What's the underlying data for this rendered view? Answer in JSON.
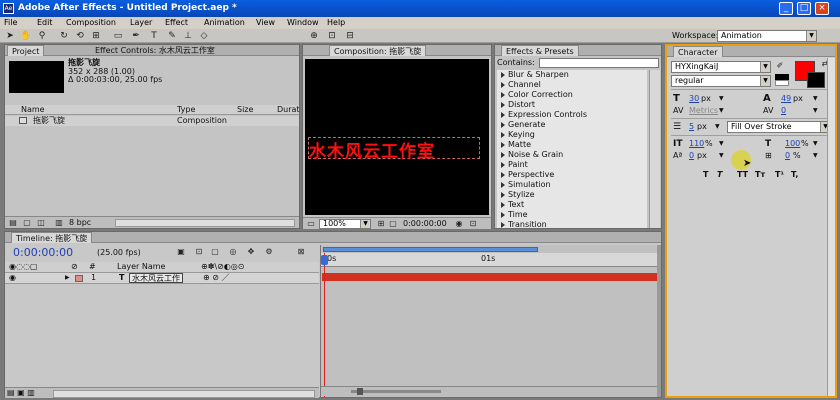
{
  "window": {
    "title": "Adobe After Effects - Untitled Project.aep *",
    "app_icon": "Ae",
    "min_glyph": "_",
    "max_glyph": "□",
    "close_glyph": "×"
  },
  "menubar": [
    "File",
    "Edit",
    "Composition",
    "Layer",
    "Effect",
    "Animation",
    "View",
    "Window",
    "Help"
  ],
  "toolbar": {
    "workspace_label": "Workspace:",
    "workspace_value": "Animation"
  },
  "project_panel": {
    "tab_project": "Project",
    "tab_effect_controls": "Effect Controls: 水木风云工作室",
    "item_name": "拖影飞旋",
    "item_dimensions": "352 x 288 (1.00)",
    "item_duration": "Δ 0:00:03:00, 25.00 fps",
    "columns": [
      "Name",
      "Type",
      "Size",
      "Durat"
    ],
    "rows": [
      {
        "name": "拖影飞旋",
        "type": "Composition"
      }
    ],
    "bpc": "8 bpc"
  },
  "composition_panel": {
    "tab": "Composition: 拖影飞旋",
    "text": "水木风云工作室",
    "zoom": "100%",
    "timecode": "0:00:00:00"
  },
  "effects_panel": {
    "tab": "Effects & Presets",
    "contains_label": "Contains:",
    "items": [
      "Blur & Sharpen",
      "Channel",
      "Color Correction",
      "Distort",
      "Expression Controls",
      "Generate",
      "Keying",
      "Matte",
      "Noise & Grain",
      "Paint",
      "Perspective",
      "Simulation",
      "Stylize",
      "Text",
      "Time",
      "Transition"
    ]
  },
  "character_panel": {
    "tab": "Character",
    "font": "HYXingKaiJ",
    "style": "regular",
    "font_size": "30",
    "font_size_unit": "px",
    "leading": "49",
    "leading_unit": "px",
    "kerning": "Metrics",
    "tracking": "0",
    "stroke_width": "5",
    "stroke_unit": "px",
    "stroke_mode": "Fill Over Stroke",
    "vscale": "110",
    "hscale": "100",
    "baseline": "0",
    "baseline_unit": "px",
    "tsume": "0",
    "percent": "%",
    "fill_color": "#ff0000",
    "style_buttons": [
      "T",
      "T",
      "TT",
      "Tт",
      "T¹",
      "T,"
    ]
  },
  "timeline_panel": {
    "tab": "Timeline: 拖影飞旋",
    "timecode": "0:00:00:00",
    "fps": "(25.00 fps)",
    "col_layer_name": "Layer Name",
    "layer_number": "1",
    "layer_type_glyph": "T",
    "layer_name": "水木风云工作",
    "ruler_start": "0s",
    "ruler_mark": "01s",
    "layer_bar_color": "#d43020"
  }
}
